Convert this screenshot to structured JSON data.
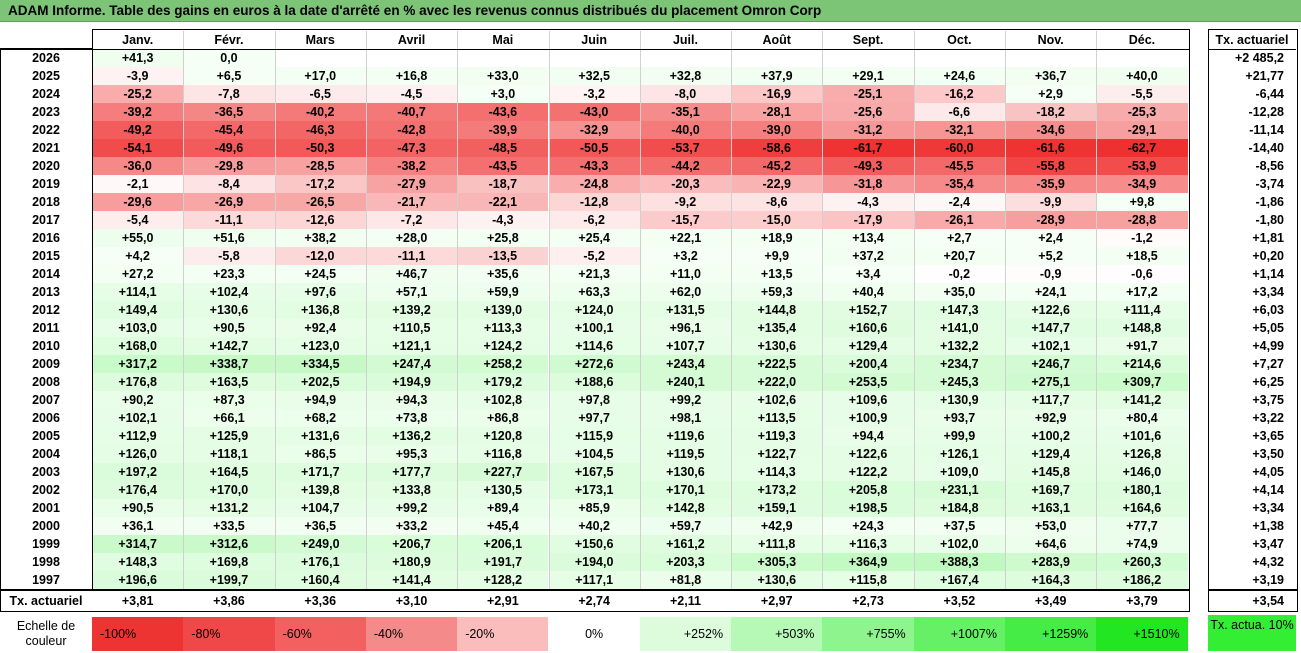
{
  "title": "ADAM Informe. Table des gains en euros à la date d'arrêté en % avec les revenus connus distribués du placement Omron Corp",
  "months": [
    "Janv.",
    "Févr.",
    "Mars",
    "Avril",
    "Mai",
    "Juin",
    "Juil.",
    "Août",
    "Sept.",
    "Oct.",
    "Nov.",
    "Déc."
  ],
  "tx_header": "Tx. actuariel",
  "chart_data": {
    "type": "table",
    "rows": [
      {
        "year": "2026",
        "values": [
          "+41,3",
          "0,0",
          "",
          "",
          "",
          "",
          "",
          "",
          "",
          "",
          "",
          ""
        ],
        "tx": "+2 485,2"
      },
      {
        "year": "2025",
        "values": [
          "-3,9",
          "+6,5",
          "+17,0",
          "+16,8",
          "+33,0",
          "+32,5",
          "+32,8",
          "+37,9",
          "+29,1",
          "+24,6",
          "+36,7",
          "+40,0"
        ],
        "tx": "+21,77"
      },
      {
        "year": "2024",
        "values": [
          "-25,2",
          "-7,8",
          "-6,5",
          "-4,5",
          "+3,0",
          "-3,2",
          "-8,0",
          "-16,9",
          "-25,1",
          "-16,2",
          "+2,9",
          "-5,5"
        ],
        "tx": "-6,44"
      },
      {
        "year": "2023",
        "values": [
          "-39,2",
          "-36,5",
          "-40,2",
          "-40,7",
          "-43,6",
          "-43,0",
          "-35,1",
          "-28,1",
          "-25,6",
          "-6,6",
          "-18,2",
          "-25,3"
        ],
        "tx": "-12,28"
      },
      {
        "year": "2022",
        "values": [
          "-49,2",
          "-45,4",
          "-46,3",
          "-42,8",
          "-39,9",
          "-32,9",
          "-40,0",
          "-39,0",
          "-31,2",
          "-32,1",
          "-34,6",
          "-29,1"
        ],
        "tx": "-11,14"
      },
      {
        "year": "2021",
        "values": [
          "-54,1",
          "-49,6",
          "-50,3",
          "-47,3",
          "-48,5",
          "-50,5",
          "-53,7",
          "-58,6",
          "-61,7",
          "-60,0",
          "-61,6",
          "-62,7"
        ],
        "tx": "-14,40"
      },
      {
        "year": "2020",
        "values": [
          "-36,0",
          "-29,8",
          "-28,5",
          "-38,2",
          "-43,5",
          "-43,3",
          "-44,2",
          "-45,2",
          "-49,3",
          "-45,5",
          "-55,8",
          "-53,9"
        ],
        "tx": "-8,56"
      },
      {
        "year": "2019",
        "values": [
          "-2,1",
          "-8,4",
          "-17,2",
          "-27,9",
          "-18,7",
          "-24,8",
          "-20,3",
          "-22,9",
          "-31,8",
          "-35,4",
          "-35,9",
          "-34,9"
        ],
        "tx": "-3,74"
      },
      {
        "year": "2018",
        "values": [
          "-29,6",
          "-26,9",
          "-26,5",
          "-21,7",
          "-22,1",
          "-12,8",
          "-9,2",
          "-8,6",
          "-4,3",
          "-2,4",
          "-9,9",
          "+9,8"
        ],
        "tx": "-1,86"
      },
      {
        "year": "2017",
        "values": [
          "-5,4",
          "-11,1",
          "-12,6",
          "-7,2",
          "-4,3",
          "-6,2",
          "-15,7",
          "-15,0",
          "-17,9",
          "-26,1",
          "-28,9",
          "-28,8"
        ],
        "tx": "-1,80"
      },
      {
        "year": "2016",
        "values": [
          "+55,0",
          "+51,6",
          "+38,2",
          "+28,0",
          "+25,8",
          "+25,4",
          "+22,1",
          "+18,9",
          "+13,4",
          "+2,7",
          "+2,4",
          "-1,2"
        ],
        "tx": "+1,81"
      },
      {
        "year": "2015",
        "values": [
          "+4,2",
          "-5,8",
          "-12,0",
          "-11,1",
          "-13,5",
          "-5,2",
          "+3,2",
          "+9,9",
          "+37,2",
          "+20,7",
          "+5,2",
          "+18,5"
        ],
        "tx": "+0,20"
      },
      {
        "year": "2014",
        "values": [
          "+27,2",
          "+23,3",
          "+24,5",
          "+46,7",
          "+35,6",
          "+21,3",
          "+11,0",
          "+13,5",
          "+3,4",
          "-0,2",
          "-0,9",
          "-0,6"
        ],
        "tx": "+1,14"
      },
      {
        "year": "2013",
        "values": [
          "+114,1",
          "+102,4",
          "+97,6",
          "+57,1",
          "+59,9",
          "+63,3",
          "+62,0",
          "+59,3",
          "+40,4",
          "+35,0",
          "+24,1",
          "+17,2"
        ],
        "tx": "+3,34"
      },
      {
        "year": "2012",
        "values": [
          "+149,4",
          "+130,6",
          "+136,8",
          "+139,2",
          "+139,0",
          "+124,0",
          "+131,5",
          "+144,8",
          "+152,7",
          "+147,3",
          "+122,6",
          "+111,4"
        ],
        "tx": "+6,03"
      },
      {
        "year": "2011",
        "values": [
          "+103,0",
          "+90,5",
          "+92,4",
          "+110,5",
          "+113,3",
          "+100,1",
          "+96,1",
          "+135,4",
          "+160,6",
          "+141,0",
          "+147,7",
          "+148,8"
        ],
        "tx": "+5,05"
      },
      {
        "year": "2010",
        "values": [
          "+168,0",
          "+142,7",
          "+123,0",
          "+121,1",
          "+124,2",
          "+114,6",
          "+107,7",
          "+130,6",
          "+129,4",
          "+132,2",
          "+102,1",
          "+91,7"
        ],
        "tx": "+4,99"
      },
      {
        "year": "2009",
        "values": [
          "+317,2",
          "+338,7",
          "+334,5",
          "+247,4",
          "+258,2",
          "+272,6",
          "+243,4",
          "+222,5",
          "+200,4",
          "+234,7",
          "+246,7",
          "+214,6"
        ],
        "tx": "+7,27"
      },
      {
        "year": "2008",
        "values": [
          "+176,8",
          "+163,5",
          "+202,5",
          "+194,9",
          "+179,2",
          "+188,6",
          "+240,1",
          "+222,0",
          "+253,5",
          "+245,3",
          "+275,1",
          "+309,7"
        ],
        "tx": "+6,25"
      },
      {
        "year": "2007",
        "values": [
          "+90,2",
          "+87,3",
          "+94,9",
          "+94,3",
          "+102,8",
          "+97,8",
          "+99,2",
          "+102,6",
          "+109,6",
          "+130,9",
          "+117,7",
          "+141,2"
        ],
        "tx": "+3,75"
      },
      {
        "year": "2006",
        "values": [
          "+102,1",
          "+66,1",
          "+68,2",
          "+73,8",
          "+86,8",
          "+97,7",
          "+98,1",
          "+113,5",
          "+100,9",
          "+93,7",
          "+92,9",
          "+80,4"
        ],
        "tx": "+3,22"
      },
      {
        "year": "2005",
        "values": [
          "+112,9",
          "+125,9",
          "+131,6",
          "+136,2",
          "+120,8",
          "+115,9",
          "+119,6",
          "+119,3",
          "+94,4",
          "+99,9",
          "+100,2",
          "+101,6"
        ],
        "tx": "+3,65"
      },
      {
        "year": "2004",
        "values": [
          "+126,0",
          "+118,1",
          "+86,5",
          "+95,3",
          "+116,8",
          "+104,5",
          "+119,5",
          "+122,7",
          "+122,6",
          "+126,1",
          "+129,4",
          "+126,8"
        ],
        "tx": "+3,50"
      },
      {
        "year": "2003",
        "values": [
          "+197,2",
          "+164,5",
          "+171,7",
          "+177,7",
          "+227,7",
          "+167,5",
          "+130,6",
          "+114,3",
          "+122,2",
          "+109,0",
          "+145,8",
          "+146,0"
        ],
        "tx": "+4,05"
      },
      {
        "year": "2002",
        "values": [
          "+176,4",
          "+170,0",
          "+139,8",
          "+133,8",
          "+130,5",
          "+173,1",
          "+170,1",
          "+173,2",
          "+205,8",
          "+231,1",
          "+169,7",
          "+180,1"
        ],
        "tx": "+4,14"
      },
      {
        "year": "2001",
        "values": [
          "+90,5",
          "+131,2",
          "+104,7",
          "+99,2",
          "+89,4",
          "+85,9",
          "+142,8",
          "+159,1",
          "+198,5",
          "+184,8",
          "+163,1",
          "+164,6"
        ],
        "tx": "+3,34"
      },
      {
        "year": "2000",
        "values": [
          "+36,1",
          "+33,5",
          "+36,5",
          "+33,2",
          "+45,4",
          "+40,2",
          "+59,7",
          "+42,9",
          "+24,3",
          "+37,5",
          "+53,0",
          "+77,7"
        ],
        "tx": "+1,38"
      },
      {
        "year": "1999",
        "values": [
          "+314,7",
          "+312,6",
          "+249,0",
          "+206,7",
          "+206,1",
          "+150,6",
          "+161,2",
          "+111,8",
          "+116,3",
          "+102,0",
          "+64,6",
          "+74,9"
        ],
        "tx": "+3,47"
      },
      {
        "year": "1998",
        "values": [
          "+148,3",
          "+169,8",
          "+176,1",
          "+180,9",
          "+191,7",
          "+194,0",
          "+203,3",
          "+305,3",
          "+364,9",
          "+388,3",
          "+283,9",
          "+260,3"
        ],
        "tx": "+4,32"
      },
      {
        "year": "1997",
        "values": [
          "+196,6",
          "+199,7",
          "+160,4",
          "+141,4",
          "+128,2",
          "+117,1",
          "+81,8",
          "+130,6",
          "+115,8",
          "+167,4",
          "+164,3",
          "+186,2"
        ],
        "tx": "+3,19"
      }
    ],
    "footer": {
      "label": "Tx. actuariel",
      "values": [
        "+3,81",
        "+3,86",
        "+3,36",
        "+3,10",
        "+2,91",
        "+2,74",
        "+2,11",
        "+2,97",
        "+2,73",
        "+3,52",
        "+3,49",
        "+3,79"
      ],
      "tx": "+3,54"
    }
  },
  "scale": {
    "label": "Echelle de couleur",
    "items": [
      {
        "text": "-100%",
        "color": "#ee3333",
        "align": "left"
      },
      {
        "text": "-80%",
        "color": "#f04848",
        "align": "left"
      },
      {
        "text": "-60%",
        "color": "#f26060",
        "align": "left"
      },
      {
        "text": "-40%",
        "color": "#f58a8a",
        "align": "left"
      },
      {
        "text": "-20%",
        "color": "#fbbcbc",
        "align": "left"
      },
      {
        "text": "0%",
        "color": "#ffffff",
        "align": "center"
      },
      {
        "text": "+252%",
        "color": "#dcfcdc",
        "align": "right"
      },
      {
        "text": "+503%",
        "color": "#b6f9b6",
        "align": "right"
      },
      {
        "text": "+755%",
        "color": "#8ef58e",
        "align": "right"
      },
      {
        "text": "+1007%",
        "color": "#66f066",
        "align": "right"
      },
      {
        "text": "+1259%",
        "color": "#45ec45",
        "align": "right"
      },
      {
        "text": "+1510%",
        "color": "#22e622",
        "align": "right"
      }
    ],
    "tx_label": "Tx. actua. 10%"
  }
}
